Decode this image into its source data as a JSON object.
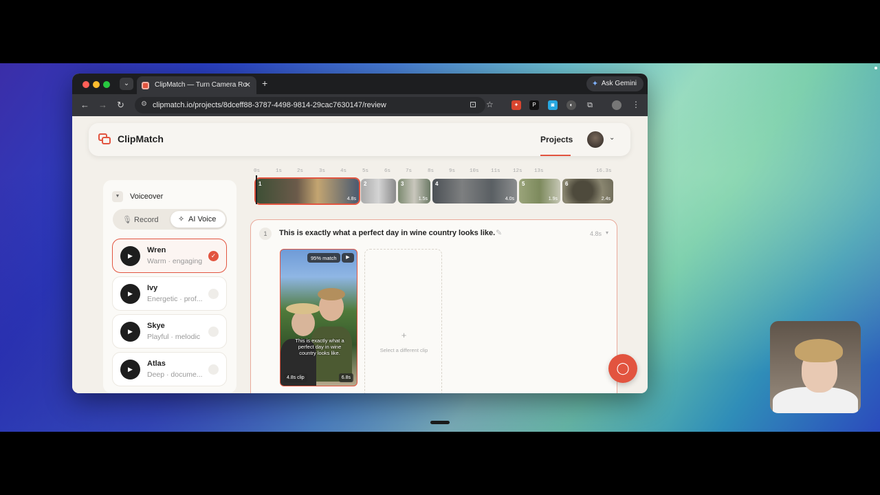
{
  "browser": {
    "tab_title": "ClipMatch — Turn Camera Ro",
    "url": "clipmatch.io/projects/8dceff88-3787-4498-9814-29cac7630147/review",
    "ask_gemini": "Ask Gemini",
    "extensions": [
      "red-ext-icon",
      "p-ext-icon",
      "blue-ext-icon",
      "globe-ext-icon",
      "puzzle-icon"
    ]
  },
  "app": {
    "name": "ClipMatch",
    "nav_projects": "Projects"
  },
  "voiceover": {
    "title": "Voiceover",
    "record_label": "Record",
    "ai_voice_label": "AI Voice",
    "voices": [
      {
        "name": "Wren",
        "desc": "Warm · engaging",
        "selected": true
      },
      {
        "name": "Ivy",
        "desc": "Energetic · prof...",
        "selected": false
      },
      {
        "name": "Skye",
        "desc": "Playful · melodic",
        "selected": false
      },
      {
        "name": "Atlas",
        "desc": "Deep · docume...",
        "selected": false
      }
    ]
  },
  "timeline": {
    "ruler": [
      "0s",
      "1s",
      "2s",
      "3s",
      "4s",
      "5s",
      "6s",
      "7s",
      "8s",
      "9s",
      "10s",
      "11s",
      "12s",
      "13s",
      "16.3s"
    ],
    "clips": [
      {
        "n": "1",
        "dur": "4.8s",
        "color": "#6b5a4a"
      },
      {
        "n": "2",
        "dur": "",
        "color": "#8a8a8a"
      },
      {
        "n": "3",
        "dur": "1.5s",
        "color": "#7c8a70"
      },
      {
        "n": "4",
        "dur": "4.0s",
        "color": "#5a5f63"
      },
      {
        "n": "5",
        "dur": "1.9s",
        "color": "#7d8a5d"
      },
      {
        "n": "6",
        "dur": "2.4s",
        "color": "#6d6a58"
      }
    ]
  },
  "segment": {
    "number": "1",
    "sentence": "This is exactly what a perfect day in wine country looks like.",
    "duration": "4.8s",
    "clip": {
      "match": "95% match",
      "caption": "This is exactly what a perfect day in wine country looks like.",
      "clip_len": "4.8s clip",
      "total_len": "6.8s"
    },
    "add_clip_label": "Select a different clip"
  },
  "colors": {
    "accent": "#e2543f"
  }
}
